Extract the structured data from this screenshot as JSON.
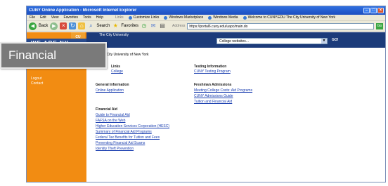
{
  "browser": {
    "title": "CUNY Online Application - Microsoft Internet Explorer",
    "menu": [
      "File",
      "Edit",
      "View",
      "Favorites",
      "Tools",
      "Help"
    ],
    "links_label": "Links",
    "links": [
      "Customize Links",
      "Windows Marketplace",
      "Windows Media",
      "Welcome to CUNY.EDU The City University of New York"
    ],
    "toolbar": {
      "back": "Back",
      "search": "Search",
      "favorites": "Favorites"
    },
    "address_label": "Address",
    "address": "https://portal6.cuny.edu/uapc/main.do",
    "go": "Go"
  },
  "page": {
    "cuny_logo_text": "CU",
    "cuny_name": "The City University",
    "we_are": "WE ARE NY",
    "college_select": "College websites...",
    "go_link": "GO!",
    "welcome": "to The City University of New York",
    "sidenav": [
      "Logout",
      "Contact"
    ],
    "sections": {
      "quick_links": {
        "title": "Links",
        "links": [
          "College"
        ]
      },
      "testing": {
        "title": "Testing Information",
        "links": [
          "CUNY Testing Program"
        ]
      },
      "general": {
        "title": "General Information",
        "links": [
          "Online Application"
        ]
      },
      "freshman": {
        "title": "Freshman Admissions",
        "links": [
          "Meeting College Costs: Aid Programs",
          "CUNY Admissions Guide",
          "Tuition and Financial Aid"
        ]
      },
      "financial_aid": {
        "title": "Financial Aid",
        "links": [
          "Guide to Financial Aid",
          "FAFSA on the Web",
          "Higher Education Services Corporation (HESC)",
          "Summary of Financial Aid Programs",
          "Federal Tax Benefits for Tuition and Fees",
          "Preventing Financial Aid Scams",
          "Identity Theft Prevention"
        ]
      }
    }
  },
  "overlay": {
    "label": "Financial"
  },
  "colors": {
    "orange": "#f28c12",
    "navy": "#1c3b7a",
    "link": "#1b3fb0"
  }
}
